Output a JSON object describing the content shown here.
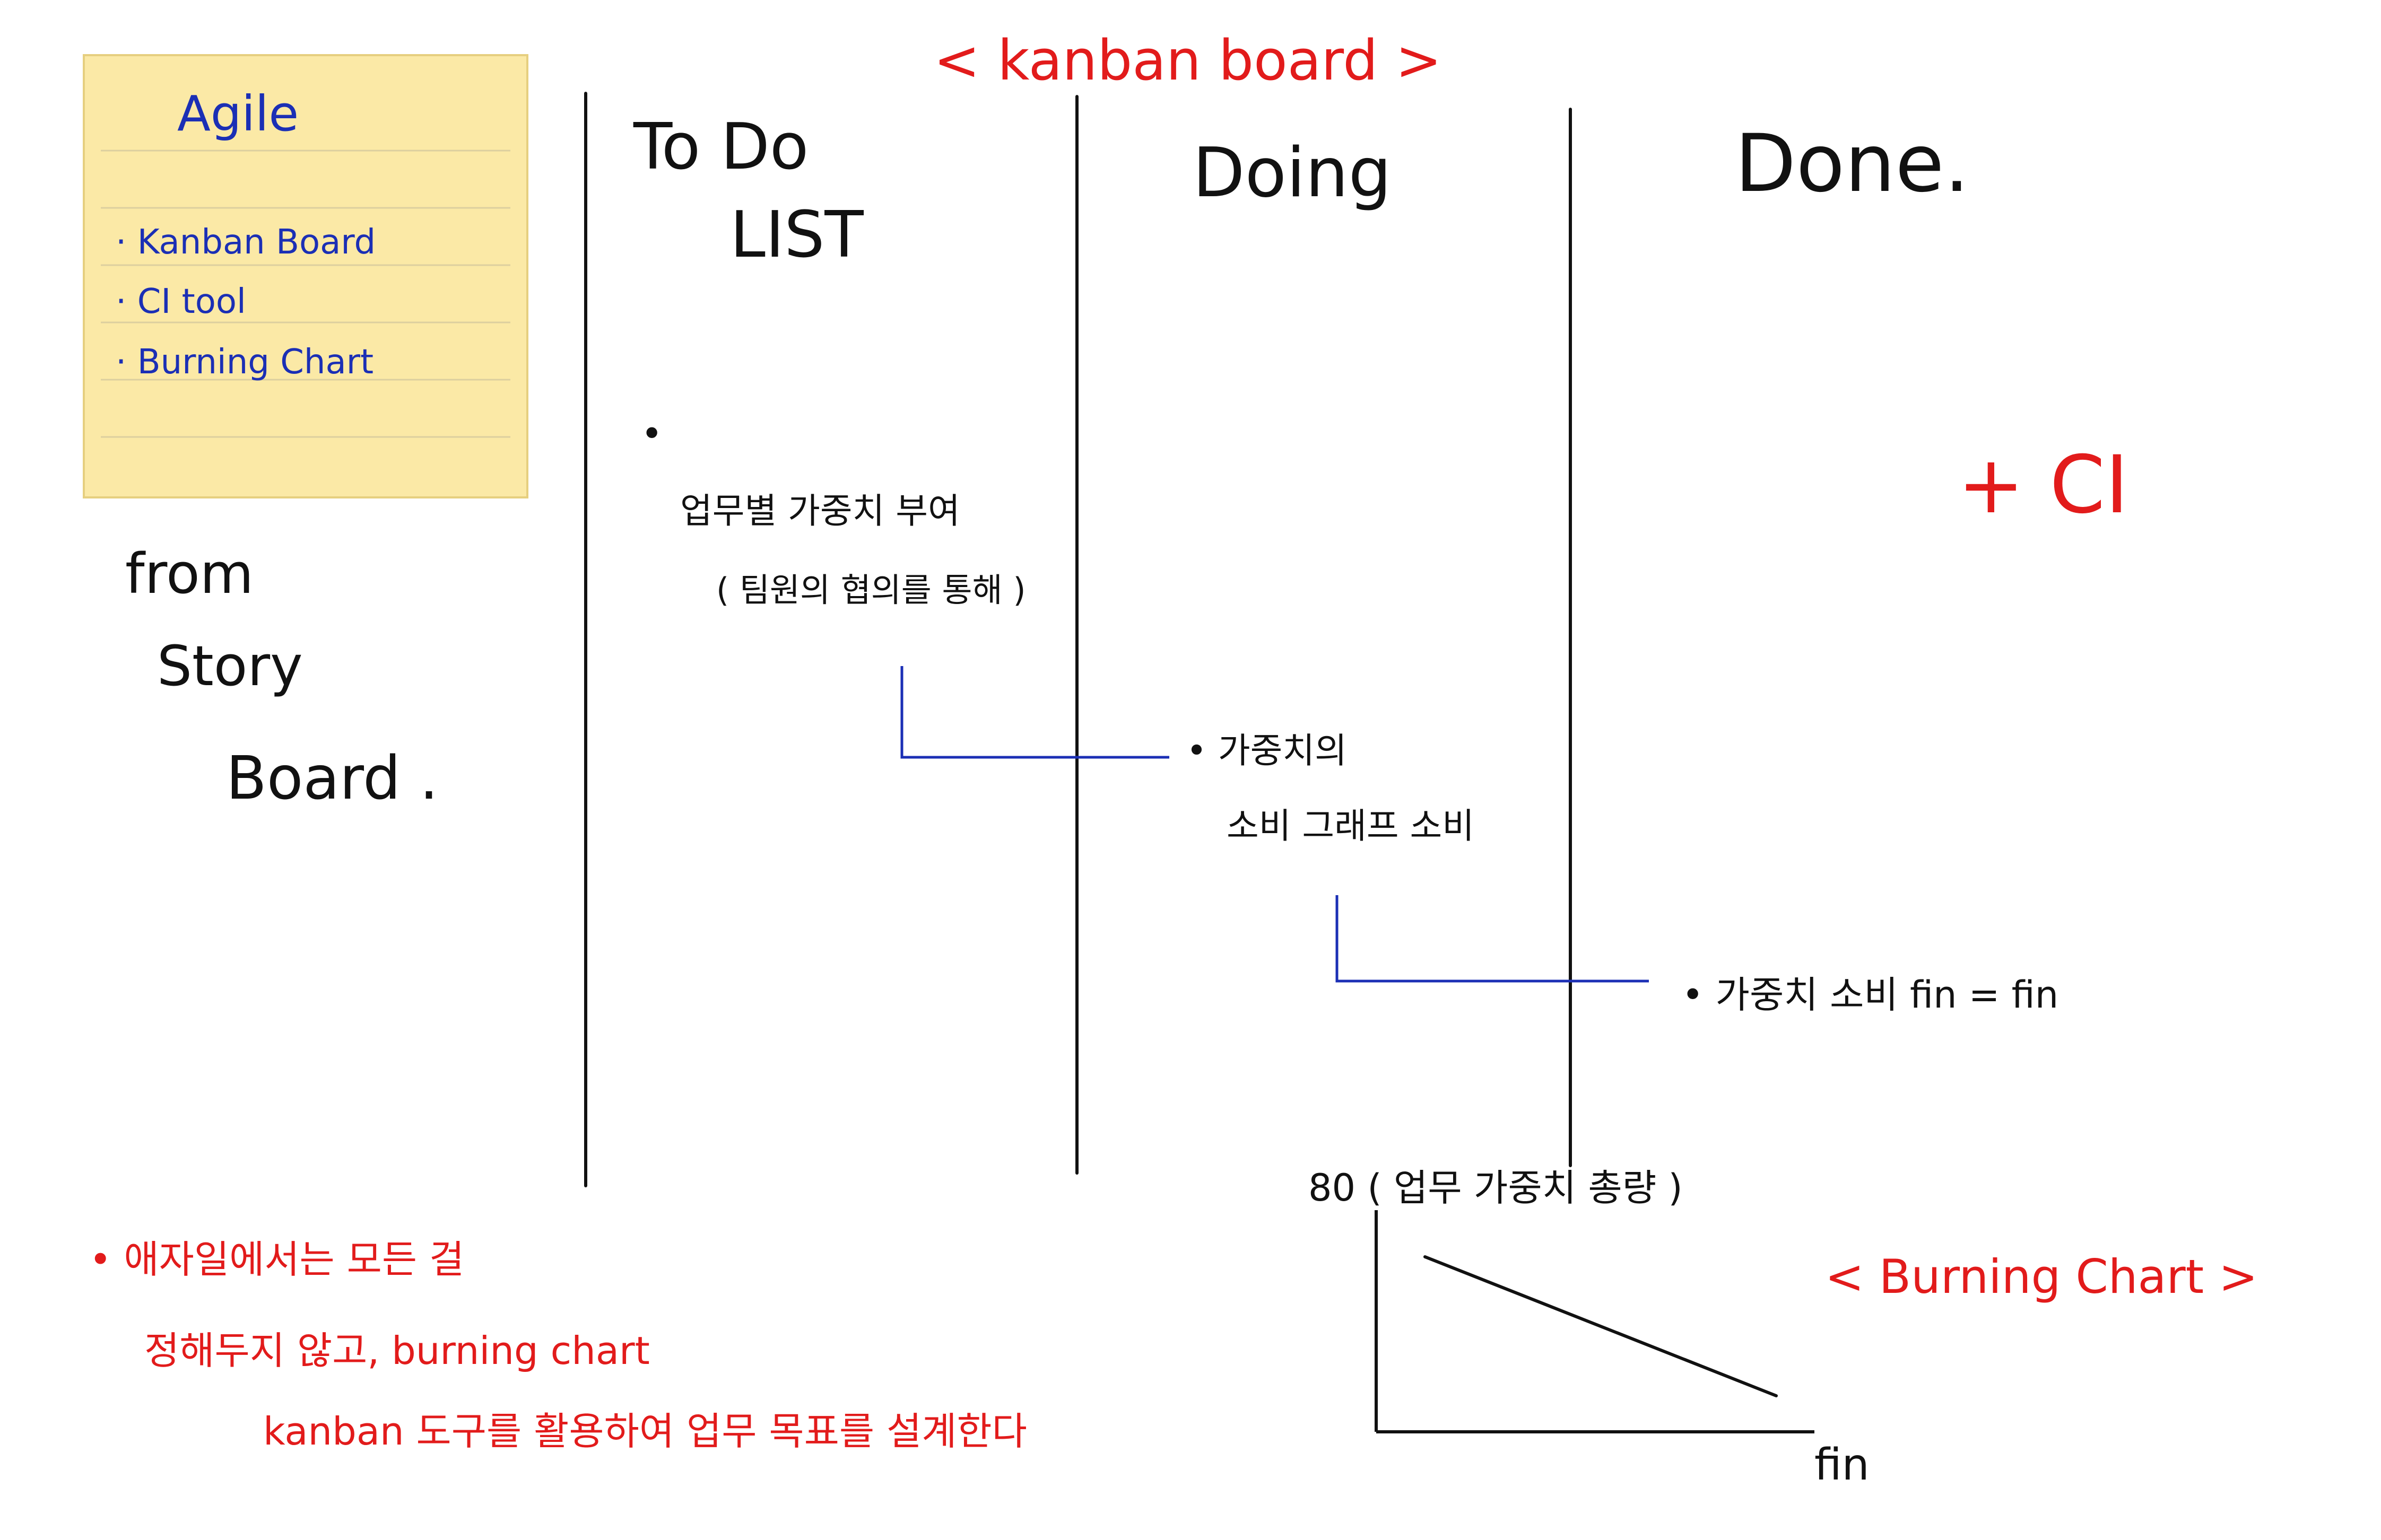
{
  "title": "< kanban board >",
  "sticky_note": {
    "title": "Agile",
    "items": [
      "· Kanban Board",
      "· CI tool",
      "· Burning Chart"
    ]
  },
  "from_note": [
    "from",
    "Story",
    "Board ."
  ],
  "columns": {
    "todo": [
      "To Do",
      "LIST"
    ],
    "doing": "Doing",
    "done": "Done."
  },
  "todo_note": {
    "bullet": "•",
    "line1": "업무별 가중치 부여",
    "line2": "( 팀원의 협의를 통해 )"
  },
  "doing_note": {
    "line1": "• 가중치의",
    "line2": "소비 그래프 소비"
  },
  "done_note": "• 가중치 소비 fin = fin",
  "plus_ci": "+ CI",
  "chart": {
    "y_label": "80 ( 업무 가중치 총량 )",
    "x_label": "fin",
    "caption": "< Burning Chart >"
  },
  "footer_note": {
    "line1": "• 애자일에서는 모든 걸",
    "line2": "정해두지 않고, burning chart",
    "line3": "kanban 도구를 활용하여 업무 목표를 설계한다"
  },
  "colors": {
    "red": "#e21b1b",
    "blue": "#1b2fb5",
    "ink": "#111111",
    "sticky": "#fbe9a6"
  }
}
